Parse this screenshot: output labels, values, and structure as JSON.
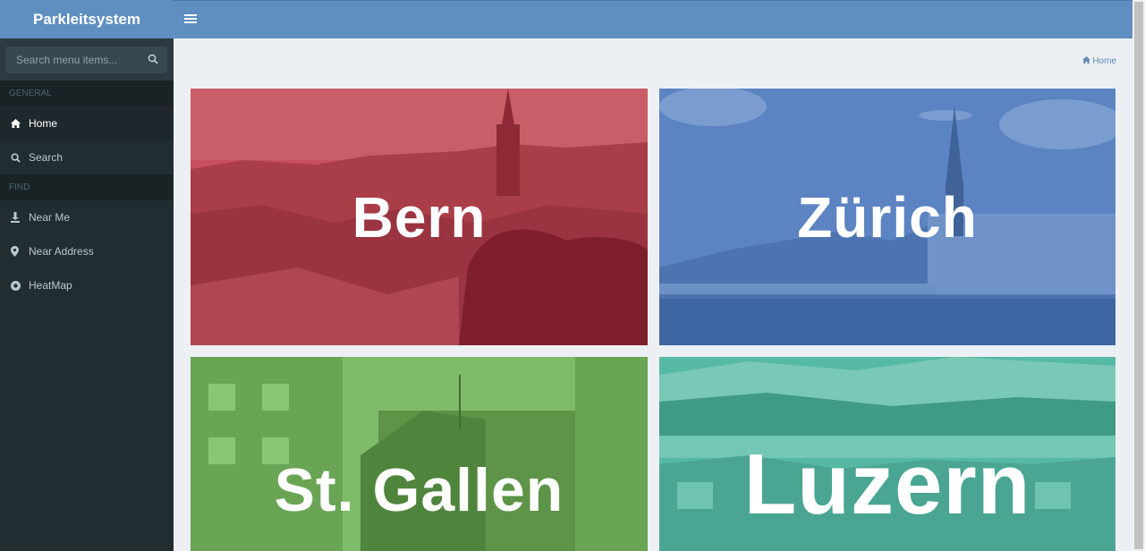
{
  "app": {
    "title": "Parkleitsystem"
  },
  "sidebar": {
    "search_placeholder": "Search menu items...",
    "sections": [
      {
        "header": "GENERAL",
        "items": [
          {
            "label": "Home",
            "icon": "home-icon",
            "active": true
          },
          {
            "label": "Search",
            "icon": "search-icon",
            "active": false
          }
        ]
      },
      {
        "header": "FIND",
        "items": [
          {
            "label": "Near Me",
            "icon": "pin-down-icon",
            "active": false
          },
          {
            "label": "Near Address",
            "icon": "map-marker-icon",
            "active": false
          },
          {
            "label": "HeatMap",
            "icon": "dot-circle-icon",
            "active": false
          }
        ]
      }
    ]
  },
  "breadcrumb": {
    "items": [
      "Home"
    ]
  },
  "cities": [
    {
      "name": "Bern",
      "color": "#c8505c"
    },
    {
      "name": "Zürich",
      "color": "#5c84c2"
    },
    {
      "name": "St. Gallen",
      "color": "#7fbc6a"
    },
    {
      "name": "Luzern",
      "color": "#55b9a4"
    }
  ],
  "colors": {
    "topbar": "#5f8ec0",
    "sidebar": "#222d32",
    "content_bg": "#ecf0f5"
  }
}
